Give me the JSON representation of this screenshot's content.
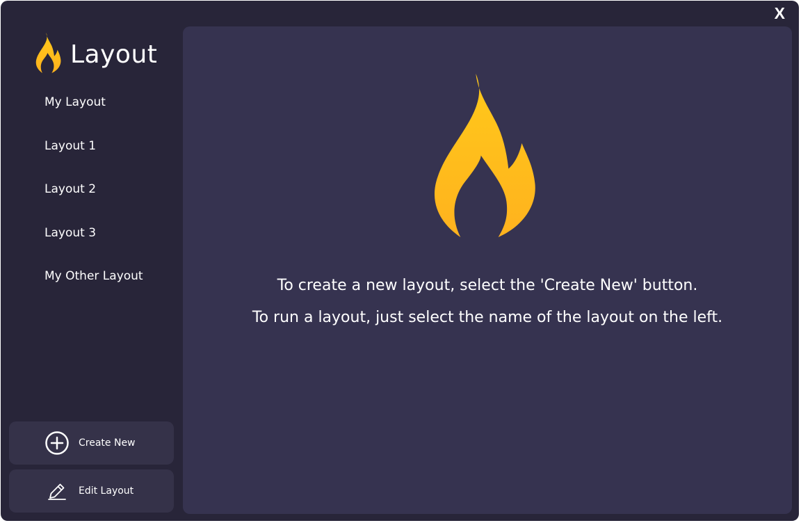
{
  "window": {
    "close_label": "X"
  },
  "brand": {
    "title": "Layout",
    "icon": "flame-icon"
  },
  "sidebar": {
    "items": [
      {
        "label": "My Layout"
      },
      {
        "label": "Layout 1"
      },
      {
        "label": "Layout 2"
      },
      {
        "label": "Layout 3"
      },
      {
        "label": "My Other Layout"
      }
    ]
  },
  "actions": {
    "create_new": {
      "label": "Create New",
      "icon": "plus-circle-icon"
    },
    "edit_layout": {
      "label": "Edit Layout",
      "icon": "pencil-icon"
    }
  },
  "main": {
    "hero_icon": "flame-icon",
    "line1": "To create a new layout, select the 'Create New' button.",
    "line2": "To run a layout, just select the name of the layout on the left."
  },
  "colors": {
    "window_bg": "#282539",
    "panel_bg": "#363350",
    "button_bg": "#353249",
    "flame_top": "#FFC91A",
    "flame_bottom": "#FFB21E",
    "text": "#FFFFFF"
  }
}
